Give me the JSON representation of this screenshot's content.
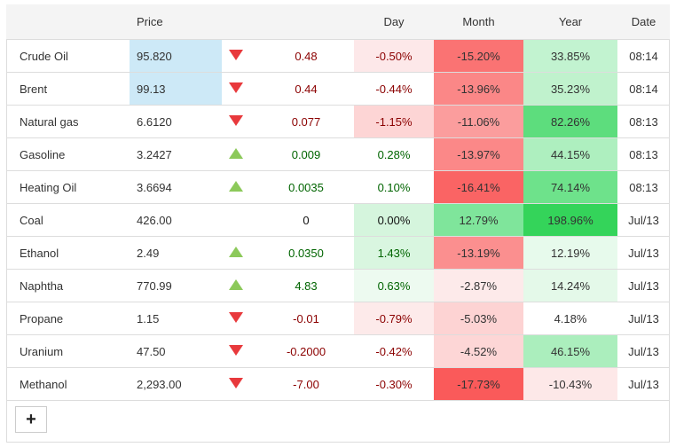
{
  "headers": {
    "name": "",
    "price": "Price",
    "arrow": "",
    "change": "",
    "day": "Day",
    "month": "Month",
    "year": "Year",
    "date": "Date"
  },
  "rows": [
    {
      "name": "Crude Oil",
      "price": "95.820",
      "price_bg": "#cde9f7",
      "dir": "down",
      "change": "0.48",
      "change_sign": "neg",
      "day": "-0.50%",
      "day_bg": "#fde8e9",
      "month": "-15.20%",
      "month_bg": "#fa7373",
      "year": "33.85%",
      "year_bg": "#c2f3d0",
      "date": "08:14"
    },
    {
      "name": "Brent",
      "price": "99.13",
      "price_bg": "#cde9f7",
      "dir": "down",
      "change": "0.44",
      "change_sign": "neg",
      "day": "-0.44%",
      "day_bg": "#ffffff",
      "month": "-13.96%",
      "month_bg": "#fb8787",
      "year": "35.23%",
      "year_bg": "#c0f2cd",
      "date": "08:14"
    },
    {
      "name": "Natural gas",
      "price": "6.6120",
      "price_bg": "",
      "dir": "down",
      "change": "0.077",
      "change_sign": "neg",
      "day": "-1.15%",
      "day_bg": "#fdd5d5",
      "month": "-11.06%",
      "month_bg": "#fb9d9d",
      "year": "82.26%",
      "year_bg": "#5ddd7d",
      "date": "08:13"
    },
    {
      "name": "Gasoline",
      "price": "3.2427",
      "price_bg": "",
      "dir": "up",
      "change": "0.009",
      "change_sign": "pos",
      "day": "0.28%",
      "day_bg": "#ffffff",
      "month": "-13.97%",
      "month_bg": "#fb8888",
      "year": "44.15%",
      "year_bg": "#aeefbf",
      "date": "08:13"
    },
    {
      "name": "Heating Oil",
      "price": "3.6694",
      "price_bg": "",
      "dir": "up",
      "change": "0.0035",
      "change_sign": "pos",
      "day": "0.10%",
      "day_bg": "#ffffff",
      "month": "-16.41%",
      "month_bg": "#fa6464",
      "year": "74.14%",
      "year_bg": "#6ee28b",
      "date": "08:13"
    },
    {
      "name": "Coal",
      "price": "426.00",
      "price_bg": "",
      "dir": "",
      "change": "0",
      "change_sign": "zero",
      "day": "0.00%",
      "day_bg": "#d5f5dd",
      "month": "12.79%",
      "month_bg": "#7fe59b",
      "year": "198.96%",
      "year_bg": "#34d45a",
      "date": "Jul/13"
    },
    {
      "name": "Ethanol",
      "price": "2.49",
      "price_bg": "",
      "dir": "up",
      "change": "0.0350",
      "change_sign": "pos",
      "day": "1.43%",
      "day_bg": "#d9f6e0",
      "month": "-13.19%",
      "month_bg": "#fb8f8f",
      "year": "12.19%",
      "year_bg": "#e7faec",
      "date": "Jul/13"
    },
    {
      "name": "Naphtha",
      "price": "770.99",
      "price_bg": "",
      "dir": "up",
      "change": "4.83",
      "change_sign": "pos",
      "day": "0.63%",
      "day_bg": "#edfaf0",
      "month": "-2.87%",
      "month_bg": "#fdeaea",
      "year": "14.24%",
      "year_bg": "#e4f9e9",
      "date": "Jul/13"
    },
    {
      "name": "Propane",
      "price": "1.15",
      "price_bg": "",
      "dir": "down",
      "change": "-0.01",
      "change_sign": "neg",
      "day": "-0.79%",
      "day_bg": "#fdeaea",
      "month": "-5.03%",
      "month_bg": "#fdd3d3",
      "year": "4.18%",
      "year_bg": "#ffffff",
      "date": "Jul/13"
    },
    {
      "name": "Uranium",
      "price": "47.50",
      "price_bg": "",
      "dir": "down",
      "change": "-0.2000",
      "change_sign": "neg",
      "day": "-0.42%",
      "day_bg": "#ffffff",
      "month": "-4.52%",
      "month_bg": "#fdd6d6",
      "year": "46.15%",
      "year_bg": "#abeebd",
      "date": "Jul/13"
    },
    {
      "name": "Methanol",
      "price": "2,293.00",
      "price_bg": "",
      "dir": "down",
      "change": "-7.00",
      "change_sign": "neg",
      "day": "-0.30%",
      "day_bg": "#ffffff",
      "month": "-17.73%",
      "month_bg": "#fa5a5a",
      "year": "-10.43%",
      "year_bg": "#fde8e8",
      "date": "Jul/13"
    }
  ],
  "add_button": {
    "label": "+",
    "icon": "plus-icon"
  }
}
